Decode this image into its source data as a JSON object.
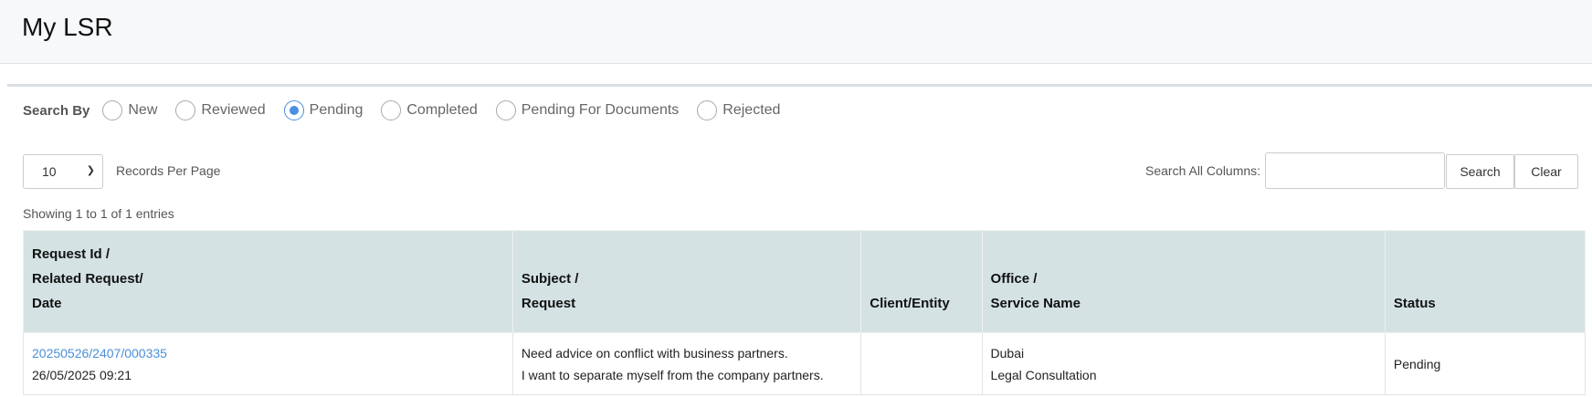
{
  "header": {
    "title": "My LSR"
  },
  "search_by": {
    "label": "Search By",
    "options": [
      {
        "label": "New",
        "checked": false
      },
      {
        "label": "Reviewed",
        "checked": false
      },
      {
        "label": "Pending",
        "checked": true
      },
      {
        "label": "Completed",
        "checked": false
      },
      {
        "label": "Pending For Documents",
        "checked": false
      },
      {
        "label": "Rejected",
        "checked": false
      }
    ]
  },
  "toolbar": {
    "records_per_page_value": "10",
    "records_per_page_label": "Records Per Page",
    "search_label": "Search All Columns:",
    "search_value": "",
    "search_button": "Search",
    "clear_button": "Clear"
  },
  "showing_text": "Showing 1 to 1 of 1 entries",
  "table": {
    "headers": {
      "request": [
        "Request Id /",
        "Related Request/",
        "Date"
      ],
      "subject": [
        "Subject /",
        "Request"
      ],
      "client": [
        "Client/Entity"
      ],
      "office": [
        "Office /",
        "Service Name"
      ],
      "status": [
        "Status"
      ]
    },
    "rows": [
      {
        "request_id": "20250526/2407/000335",
        "date": "26/05/2025 09:21",
        "subject": "Need advice on conflict with business partners.",
        "request": "I want to separate myself from the company partners.",
        "client": "",
        "office": "Dubai",
        "service": "Legal Consultation",
        "status": "Pending"
      }
    ]
  },
  "colors": {
    "accent": "#4a90e2",
    "header_bg": "#d4e2e3",
    "link": "#4a8fd8"
  }
}
